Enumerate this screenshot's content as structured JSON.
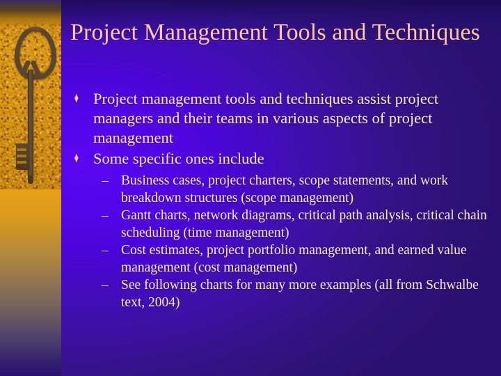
{
  "slide": {
    "title": "Project Management Tools and Techniques",
    "colors": {
      "title_text": "#ffc9a0",
      "body_text": "#fceef2",
      "bullet_diamond": "#ffc08a",
      "background_violet": "#5a07f2",
      "background_dark": "#2a1070",
      "sidebar_orange": "#e7a114"
    },
    "sidebar": {
      "image_name": "vintage-key-on-sand-photo",
      "key_icon": "key-icon"
    },
    "bullets": [
      {
        "glyph": "♦",
        "text": "Project management tools and techniques assist project managers and their teams in various aspects of project management",
        "sub": []
      },
      {
        "glyph": "♦",
        "text": "Some specific ones include",
        "sub": [
          {
            "glyph": "–",
            "text": "Business cases, project charters, scope statements, and work breakdown structures (scope management)"
          },
          {
            "glyph": "–",
            "text": "Gantt charts, network diagrams, critical path analysis, critical chain scheduling (time management)"
          },
          {
            "glyph": "–",
            "text": "Cost estimates, project portfolio management, and earned value management (cost management)"
          },
          {
            "glyph": "–",
            "text": "See following charts for many more examples (all from Schwalbe text, 2004)"
          }
        ]
      }
    ]
  }
}
